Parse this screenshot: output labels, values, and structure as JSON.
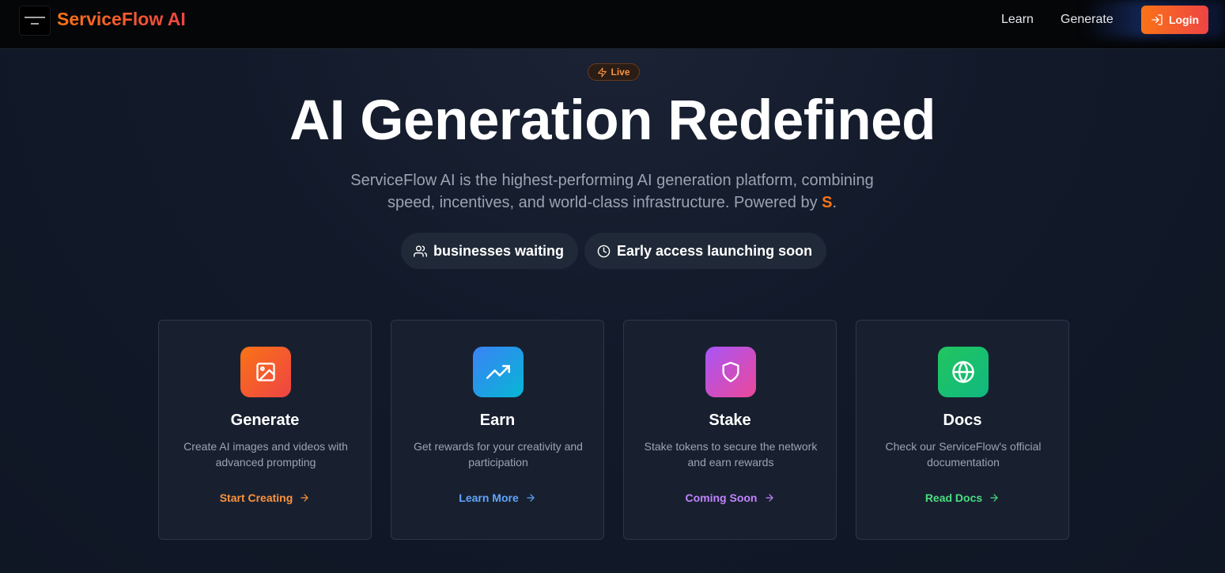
{
  "header": {
    "brand": "ServiceFlow AI",
    "nav": [
      {
        "label": "Learn"
      },
      {
        "label": "Generate"
      }
    ],
    "login_label": "Login"
  },
  "hero": {
    "badge": "Live",
    "title": "AI Generation Redefined",
    "subtitle_line1": "ServiceFlow AI is the highest-performing AI generation platform, combining",
    "subtitle_line2": "speed, incentives, and world-class infrastructure. Powered by ",
    "subtitle_accent": "S",
    "subtitle_end": ".",
    "pills": [
      {
        "label": "businesses waiting",
        "icon": "users-icon"
      },
      {
        "label": "Early access launching soon",
        "icon": "clock-icon"
      }
    ]
  },
  "cards": [
    {
      "title": "Generate",
      "desc": "Create AI images and videos with advanced prompting",
      "link": "Start Creating",
      "icon": "image-icon",
      "color": "#f97316",
      "link_color": "#fb923c"
    },
    {
      "title": "Earn",
      "desc": "Get rewards for your creativity and participation",
      "link": "Learn More",
      "icon": "trending-up-icon",
      "color": "#3b82f6",
      "link_color": "#60a5fa"
    },
    {
      "title": "Stake",
      "desc": "Stake tokens to secure the network and earn rewards",
      "link": "Coming Soon",
      "icon": "shield-icon",
      "color": "#a855f7",
      "link_color": "#c084fc"
    },
    {
      "title": "Docs",
      "desc": "Check our ServiceFlow's official documentation",
      "link": "Read Docs",
      "icon": "globe-icon",
      "color": "#22c55e",
      "link_color": "#4ade80"
    }
  ]
}
